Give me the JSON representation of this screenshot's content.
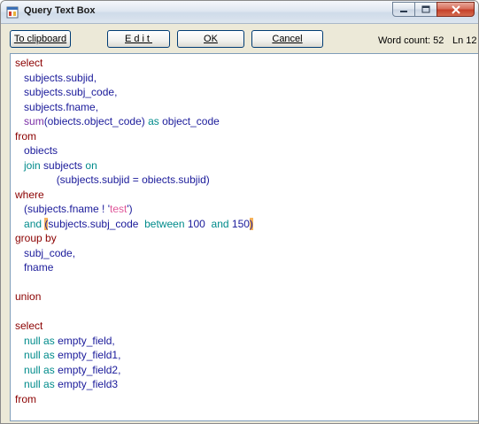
{
  "window": {
    "title": "Query Text Box"
  },
  "toolbar": {
    "clipboard_label": "To clipboard",
    "edit_label": "Edit",
    "ok_label": "OK",
    "cancel_label": "Cancel",
    "word_count": "Word count: 52",
    "line_number": "Ln 12"
  },
  "colors": {
    "keyword": "#8b0000",
    "subkeyword": "#008b8b",
    "function": "#7b2fa6",
    "identifier": "#1a1a9a",
    "string": "#e0589a",
    "bracket_highlight": "#f7b35a"
  },
  "icons": {
    "app": "app-window-icon",
    "minimize": "minimize-icon",
    "maximize": "maximize-icon",
    "close": "close-icon"
  },
  "editor": {
    "lines": [
      [
        {
          "t": "select",
          "c": "kw"
        }
      ],
      [
        {
          "t": "   ",
          "c": ""
        },
        {
          "t": "subjects.subjid,",
          "c": "id"
        }
      ],
      [
        {
          "t": "   ",
          "c": ""
        },
        {
          "t": "subjects.subj_code,",
          "c": "id"
        }
      ],
      [
        {
          "t": "   ",
          "c": ""
        },
        {
          "t": "subjects.fname,",
          "c": "id"
        }
      ],
      [
        {
          "t": "   ",
          "c": ""
        },
        {
          "t": "sum",
          "c": "fn"
        },
        {
          "t": "(obiects.object_code) ",
          "c": "id"
        },
        {
          "t": "as",
          "c": "sub"
        },
        {
          "t": " object_code",
          "c": "id"
        }
      ],
      [
        {
          "t": "from",
          "c": "kw"
        }
      ],
      [
        {
          "t": "   ",
          "c": ""
        },
        {
          "t": "obiects",
          "c": "id"
        }
      ],
      [
        {
          "t": "   ",
          "c": ""
        },
        {
          "t": "join",
          "c": "sub"
        },
        {
          "t": " subjects ",
          "c": "id"
        },
        {
          "t": "on",
          "c": "sub"
        }
      ],
      [
        {
          "t": "              ",
          "c": ""
        },
        {
          "t": "(subjects.subjid = obiects.subjid)",
          "c": "id"
        }
      ],
      [
        {
          "t": "where",
          "c": "kw"
        }
      ],
      [
        {
          "t": "   ",
          "c": ""
        },
        {
          "t": "(subjects.fname ! '",
          "c": "id"
        },
        {
          "t": "test",
          "c": "str"
        },
        {
          "t": "')",
          "c": "id"
        }
      ],
      [
        {
          "t": "   ",
          "c": ""
        },
        {
          "t": "and",
          "c": "sub"
        },
        {
          "t": " ",
          "c": ""
        },
        {
          "t": "(",
          "c": "id hl"
        },
        {
          "t": "subjects.subj_code  ",
          "c": "id"
        },
        {
          "t": "between",
          "c": "sub"
        },
        {
          "t": " 100  ",
          "c": "num"
        },
        {
          "t": "and",
          "c": "sub"
        },
        {
          "t": " 150",
          "c": "num"
        },
        {
          "t": ")",
          "c": "id hl"
        }
      ],
      [
        {
          "t": "group by",
          "c": "kw"
        }
      ],
      [
        {
          "t": "   ",
          "c": ""
        },
        {
          "t": "subj_code,",
          "c": "id"
        }
      ],
      [
        {
          "t": "   ",
          "c": ""
        },
        {
          "t": "fname",
          "c": "id"
        }
      ],
      [
        {
          "t": "",
          "c": ""
        }
      ],
      [
        {
          "t": "union",
          "c": "kw"
        }
      ],
      [
        {
          "t": "",
          "c": ""
        }
      ],
      [
        {
          "t": "select",
          "c": "kw"
        }
      ],
      [
        {
          "t": "   ",
          "c": ""
        },
        {
          "t": "null",
          "c": "sub"
        },
        {
          "t": " ",
          "c": ""
        },
        {
          "t": "as",
          "c": "sub"
        },
        {
          "t": " empty_field,",
          "c": "id"
        }
      ],
      [
        {
          "t": "   ",
          "c": ""
        },
        {
          "t": "null",
          "c": "sub"
        },
        {
          "t": " ",
          "c": ""
        },
        {
          "t": "as",
          "c": "sub"
        },
        {
          "t": " empty_field1,",
          "c": "id"
        }
      ],
      [
        {
          "t": "   ",
          "c": ""
        },
        {
          "t": "null",
          "c": "sub"
        },
        {
          "t": " ",
          "c": ""
        },
        {
          "t": "as",
          "c": "sub"
        },
        {
          "t": " empty_field2,",
          "c": "id"
        }
      ],
      [
        {
          "t": "   ",
          "c": ""
        },
        {
          "t": "null",
          "c": "sub"
        },
        {
          "t": " ",
          "c": ""
        },
        {
          "t": "as",
          "c": "sub"
        },
        {
          "t": " empty_field3",
          "c": "id"
        }
      ],
      [
        {
          "t": "from",
          "c": "kw"
        }
      ]
    ]
  }
}
